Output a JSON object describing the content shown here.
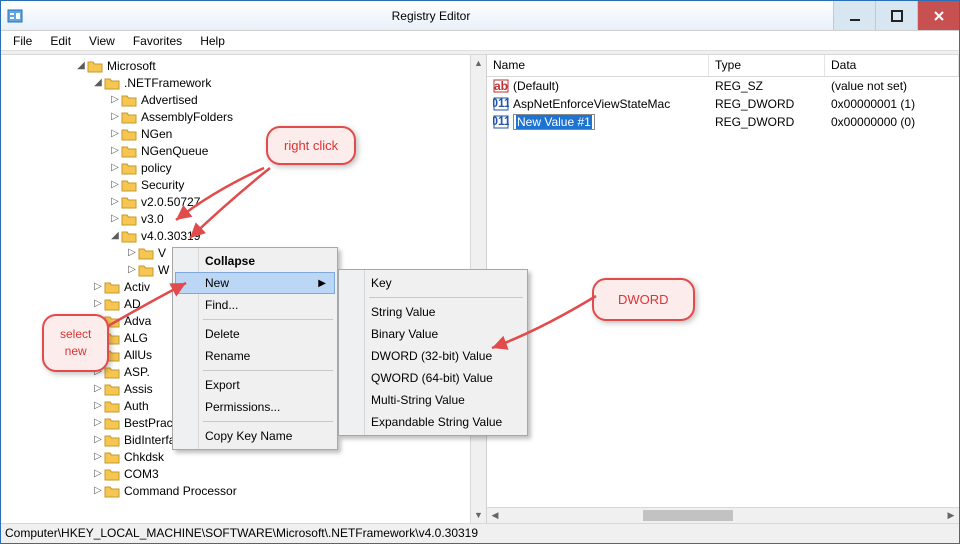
{
  "window": {
    "title": "Registry Editor",
    "icon": "regedit-icon"
  },
  "menubar": [
    "File",
    "Edit",
    "View",
    "Favorites",
    "Help"
  ],
  "tree": {
    "root": "Microsoft",
    "netframework": ".NETFramework",
    "children1": [
      "Advertised",
      "AssemblyFolders",
      "NGen",
      "NGenQueue",
      "policy",
      "Security",
      "v2.0.50727",
      "v3.0"
    ],
    "v4": "v4.0.30319",
    "v4_children": [
      "V",
      "W"
    ],
    "after": [
      "Activ",
      "AD",
      "Adva",
      "ALG",
      "AllUs",
      "ASP.",
      "Assis",
      "Auth",
      "BestPractices",
      "BidInterface",
      "Chkdsk",
      "COM3",
      "Command Processor"
    ]
  },
  "list": {
    "headers": {
      "name": "Name",
      "type": "Type",
      "data": "Data"
    },
    "rows": [
      {
        "icon": "string-value-icon",
        "name": "(Default)",
        "type": "REG_SZ",
        "data": "(value not set)"
      },
      {
        "icon": "dword-value-icon",
        "name": "AspNetEnforceViewStateMac",
        "type": "REG_DWORD",
        "data": "0x00000001 (1)"
      },
      {
        "icon": "dword-value-icon",
        "name": "New Value #1",
        "type": "REG_DWORD",
        "data": "0x00000000 (0)",
        "editing": true
      }
    ]
  },
  "ctx1": {
    "items": [
      {
        "label": "Collapse",
        "bold": true
      },
      {
        "label": "New",
        "sub": true,
        "hl": true
      },
      {
        "label": "Find..."
      },
      {
        "sep": true
      },
      {
        "label": "Delete"
      },
      {
        "label": "Rename"
      },
      {
        "sep": true
      },
      {
        "label": "Export"
      },
      {
        "label": "Permissions..."
      },
      {
        "sep": true
      },
      {
        "label": "Copy Key Name"
      }
    ]
  },
  "ctx2": {
    "items": [
      {
        "label": "Key"
      },
      {
        "sep": true
      },
      {
        "label": "String Value"
      },
      {
        "label": "Binary Value"
      },
      {
        "label": "DWORD (32-bit) Value"
      },
      {
        "label": "QWORD (64-bit) Value"
      },
      {
        "label": "Multi-String Value"
      },
      {
        "label": "Expandable String Value"
      }
    ]
  },
  "callouts": {
    "right": "right click",
    "select1": "select",
    "select2": "new",
    "dword": "DWORD"
  },
  "statusbar": "Computer\\HKEY_LOCAL_MACHINE\\SOFTWARE\\Microsoft\\.NETFramework\\v4.0.30319"
}
